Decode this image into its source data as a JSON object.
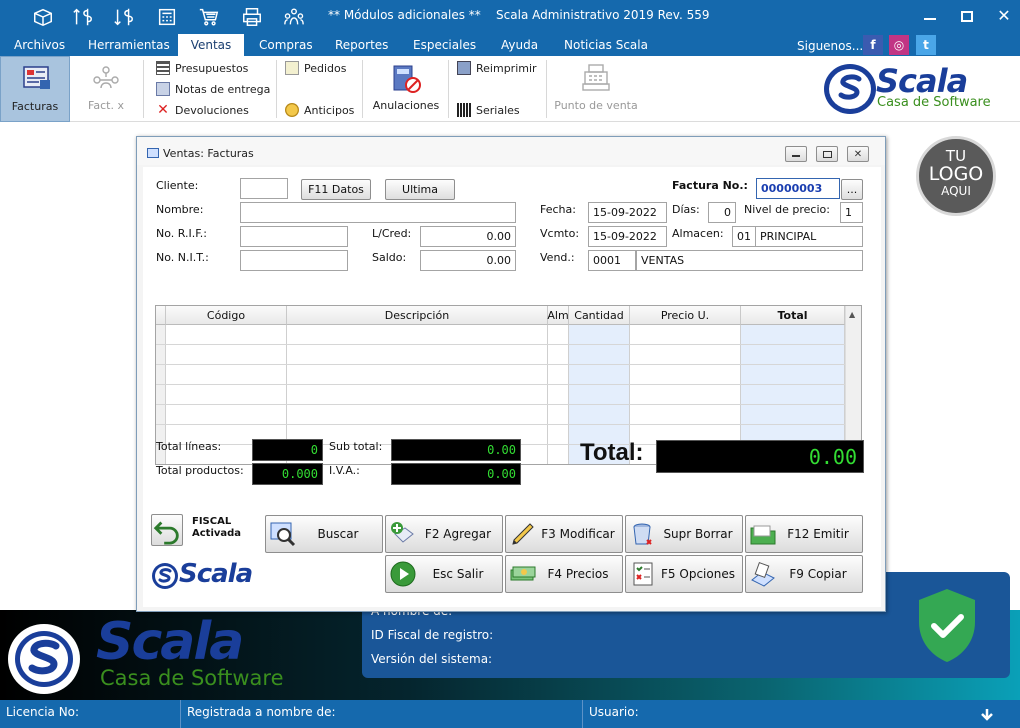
{
  "titlebar": {
    "title": "** Módulos adicionales **    Scala Administrativo 2019 Rev. 559",
    "icons": [
      "box-icon",
      "dollar-up-icon",
      "dollar-down-icon",
      "calculator-icon",
      "cart-icon",
      "printer-icon",
      "users-icon"
    ]
  },
  "menu": {
    "items": [
      "Archivos",
      "Herramientas",
      "Ventas",
      "Compras",
      "Reportes",
      "Especiales",
      "Ayuda",
      "Noticias Scala"
    ],
    "siguenos": "Siguenos...",
    "social": [
      "f",
      "◎",
      "t"
    ]
  },
  "ribbon": {
    "facturas": "Facturas",
    "factx": "Fact. x",
    "presupuestos": "Presupuestos",
    "notas": "Notas de entrega",
    "devoluciones": "Devoluciones",
    "pedidos": "Pedidos",
    "anticipos": "Anticipos",
    "anulaciones": "Anulaciones",
    "reimprimir": "Reimprimir",
    "seriales": "Seriales",
    "punto": "Punto de venta"
  },
  "brand": {
    "name": "Scala",
    "tagline": "Casa de Software",
    "logo_tu": "TU",
    "logo_logo": "LOGO",
    "logo_aqui": "AQUI"
  },
  "dialog": {
    "title": "Ventas: Facturas",
    "cliente_label": "Cliente:",
    "cliente_value": "",
    "f11_button": "F11 Datos",
    "ultima_button": "Ultima",
    "factura_label": "Factura No.:",
    "factura_value": "00000003",
    "more_button": "...",
    "nombre_label": "Nombre:",
    "nombre_value": "",
    "fecha_label": "Fecha:",
    "fecha_value": "15-09-2022",
    "dias_label": "Días:",
    "dias_value": "0",
    "nivel_label": "Nivel de precio:",
    "nivel_value": "1",
    "rif_label": "No. R.I.F.:",
    "rif_value": "",
    "lcred_label": "L/Cred:",
    "lcred_value": "0.00",
    "vcmto_label": "Vcmto:",
    "vcmto_value": "15-09-2022",
    "almacen_label": "Almacen:",
    "almacen_code": "01",
    "almacen_name": "PRINCIPAL",
    "nit_label": "No. N.I.T.:",
    "nit_value": "",
    "saldo_label": "Saldo:",
    "saldo_value": "0.00",
    "vend_label": "Vend.:",
    "vend_code": "0001",
    "vend_name": "VENTAS",
    "grid_headers": [
      "Código",
      "Descripción",
      "Alm",
      "Cantidad",
      "Precio U.",
      "Total"
    ],
    "total_lineas_label": "Total líneas:",
    "total_lineas_value": "0",
    "total_productos_label": "Total productos:",
    "total_productos_value": "0.000",
    "subtotal_label": "Sub total:",
    "subtotal_value": "0.00",
    "iva_label": "I.V.A.:",
    "iva_value": "0.00",
    "total_label": "Total:",
    "total_value": "0.00",
    "fiscal_label": "FISCAL",
    "fiscal_status": "Activada",
    "buttons": {
      "buscar": "Buscar",
      "agregar": "F2 Agregar",
      "modificar": "F3 Modificar",
      "borrar": "Supr Borrar",
      "emitir": "F12 Emitir",
      "salir": "Esc Salir",
      "precios": "F4 Precios",
      "opciones": "F5 Opciones",
      "copiar": "F9 Copiar"
    }
  },
  "info": {
    "nombre_de": "A nombre de:",
    "id_fiscal": "ID Fiscal de registro:",
    "version": "Versión del sistema:"
  },
  "status": {
    "licencia": "Licencia No:",
    "registrada": "Registrada a nombre de:",
    "usuario": "Usuario:"
  },
  "colors": {
    "accent": "#1569ad",
    "brand_blue": "#1a3e9a",
    "brand_green": "#3a8f1e",
    "lcd_green": "#33dd33"
  }
}
